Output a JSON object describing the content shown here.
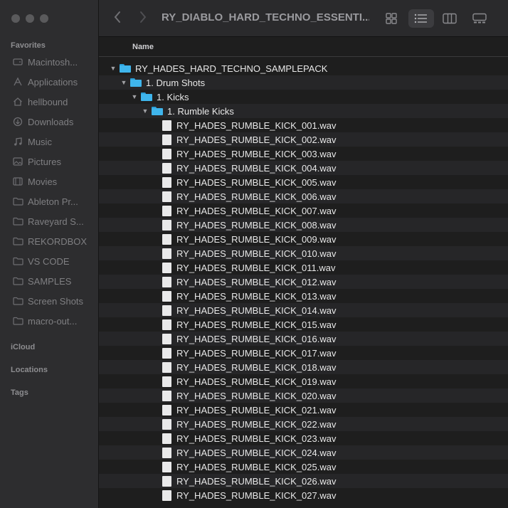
{
  "window": {
    "title": "RY_DIABLO_HARD_TECHNO_ESSENTI..."
  },
  "sidebar": {
    "favorites_label": "Favorites",
    "items": [
      {
        "label": "Macintosh...",
        "icon": "disk-icon"
      },
      {
        "label": "Applications",
        "icon": "applications-icon"
      },
      {
        "label": "hellbound",
        "icon": "home-icon"
      },
      {
        "label": "Downloads",
        "icon": "downloads-icon"
      },
      {
        "label": "Music",
        "icon": "music-icon"
      },
      {
        "label": "Pictures",
        "icon": "pictures-icon"
      },
      {
        "label": "Movies",
        "icon": "movies-icon"
      },
      {
        "label": "Ableton Pr...",
        "icon": "folder-icon"
      },
      {
        "label": "Raveyard S...",
        "icon": "folder-icon"
      },
      {
        "label": "REKORDBOX",
        "icon": "folder-icon"
      },
      {
        "label": "VS CODE",
        "icon": "folder-icon"
      },
      {
        "label": "SAMPLES",
        "icon": "folder-icon"
      },
      {
        "label": "Screen Shots",
        "icon": "folder-icon"
      },
      {
        "label": "macro-out...",
        "icon": "folder-icon"
      }
    ],
    "icloud_label": "iCloud",
    "locations_label": "Locations",
    "tags_label": "Tags"
  },
  "list": {
    "column_name": "Name",
    "tree": [
      {
        "name": "RY_HADES_HARD_TECHNO_SAMPLEPACK",
        "level": 0,
        "type": "folder"
      },
      {
        "name": "1. Drum Shots",
        "level": 1,
        "type": "folder"
      },
      {
        "name": "1. Kicks",
        "level": 2,
        "type": "folder"
      },
      {
        "name": "1. Rumble Kicks",
        "level": 3,
        "type": "folder"
      }
    ],
    "files": [
      "RY_HADES_RUMBLE_KICK_001.wav",
      "RY_HADES_RUMBLE_KICK_002.wav",
      "RY_HADES_RUMBLE_KICK_003.wav",
      "RY_HADES_RUMBLE_KICK_004.wav",
      "RY_HADES_RUMBLE_KICK_005.wav",
      "RY_HADES_RUMBLE_KICK_006.wav",
      "RY_HADES_RUMBLE_KICK_007.wav",
      "RY_HADES_RUMBLE_KICK_008.wav",
      "RY_HADES_RUMBLE_KICK_009.wav",
      "RY_HADES_RUMBLE_KICK_010.wav",
      "RY_HADES_RUMBLE_KICK_011.wav",
      "RY_HADES_RUMBLE_KICK_012.wav",
      "RY_HADES_RUMBLE_KICK_013.wav",
      "RY_HADES_RUMBLE_KICK_014.wav",
      "RY_HADES_RUMBLE_KICK_015.wav",
      "RY_HADES_RUMBLE_KICK_016.wav",
      "RY_HADES_RUMBLE_KICK_017.wav",
      "RY_HADES_RUMBLE_KICK_018.wav",
      "RY_HADES_RUMBLE_KICK_019.wav",
      "RY_HADES_RUMBLE_KICK_020.wav",
      "RY_HADES_RUMBLE_KICK_021.wav",
      "RY_HADES_RUMBLE_KICK_022.wav",
      "RY_HADES_RUMBLE_KICK_023.wav",
      "RY_HADES_RUMBLE_KICK_024.wav",
      "RY_HADES_RUMBLE_KICK_025.wav",
      "RY_HADES_RUMBLE_KICK_026.wav",
      "RY_HADES_RUMBLE_KICK_027.wav"
    ]
  }
}
